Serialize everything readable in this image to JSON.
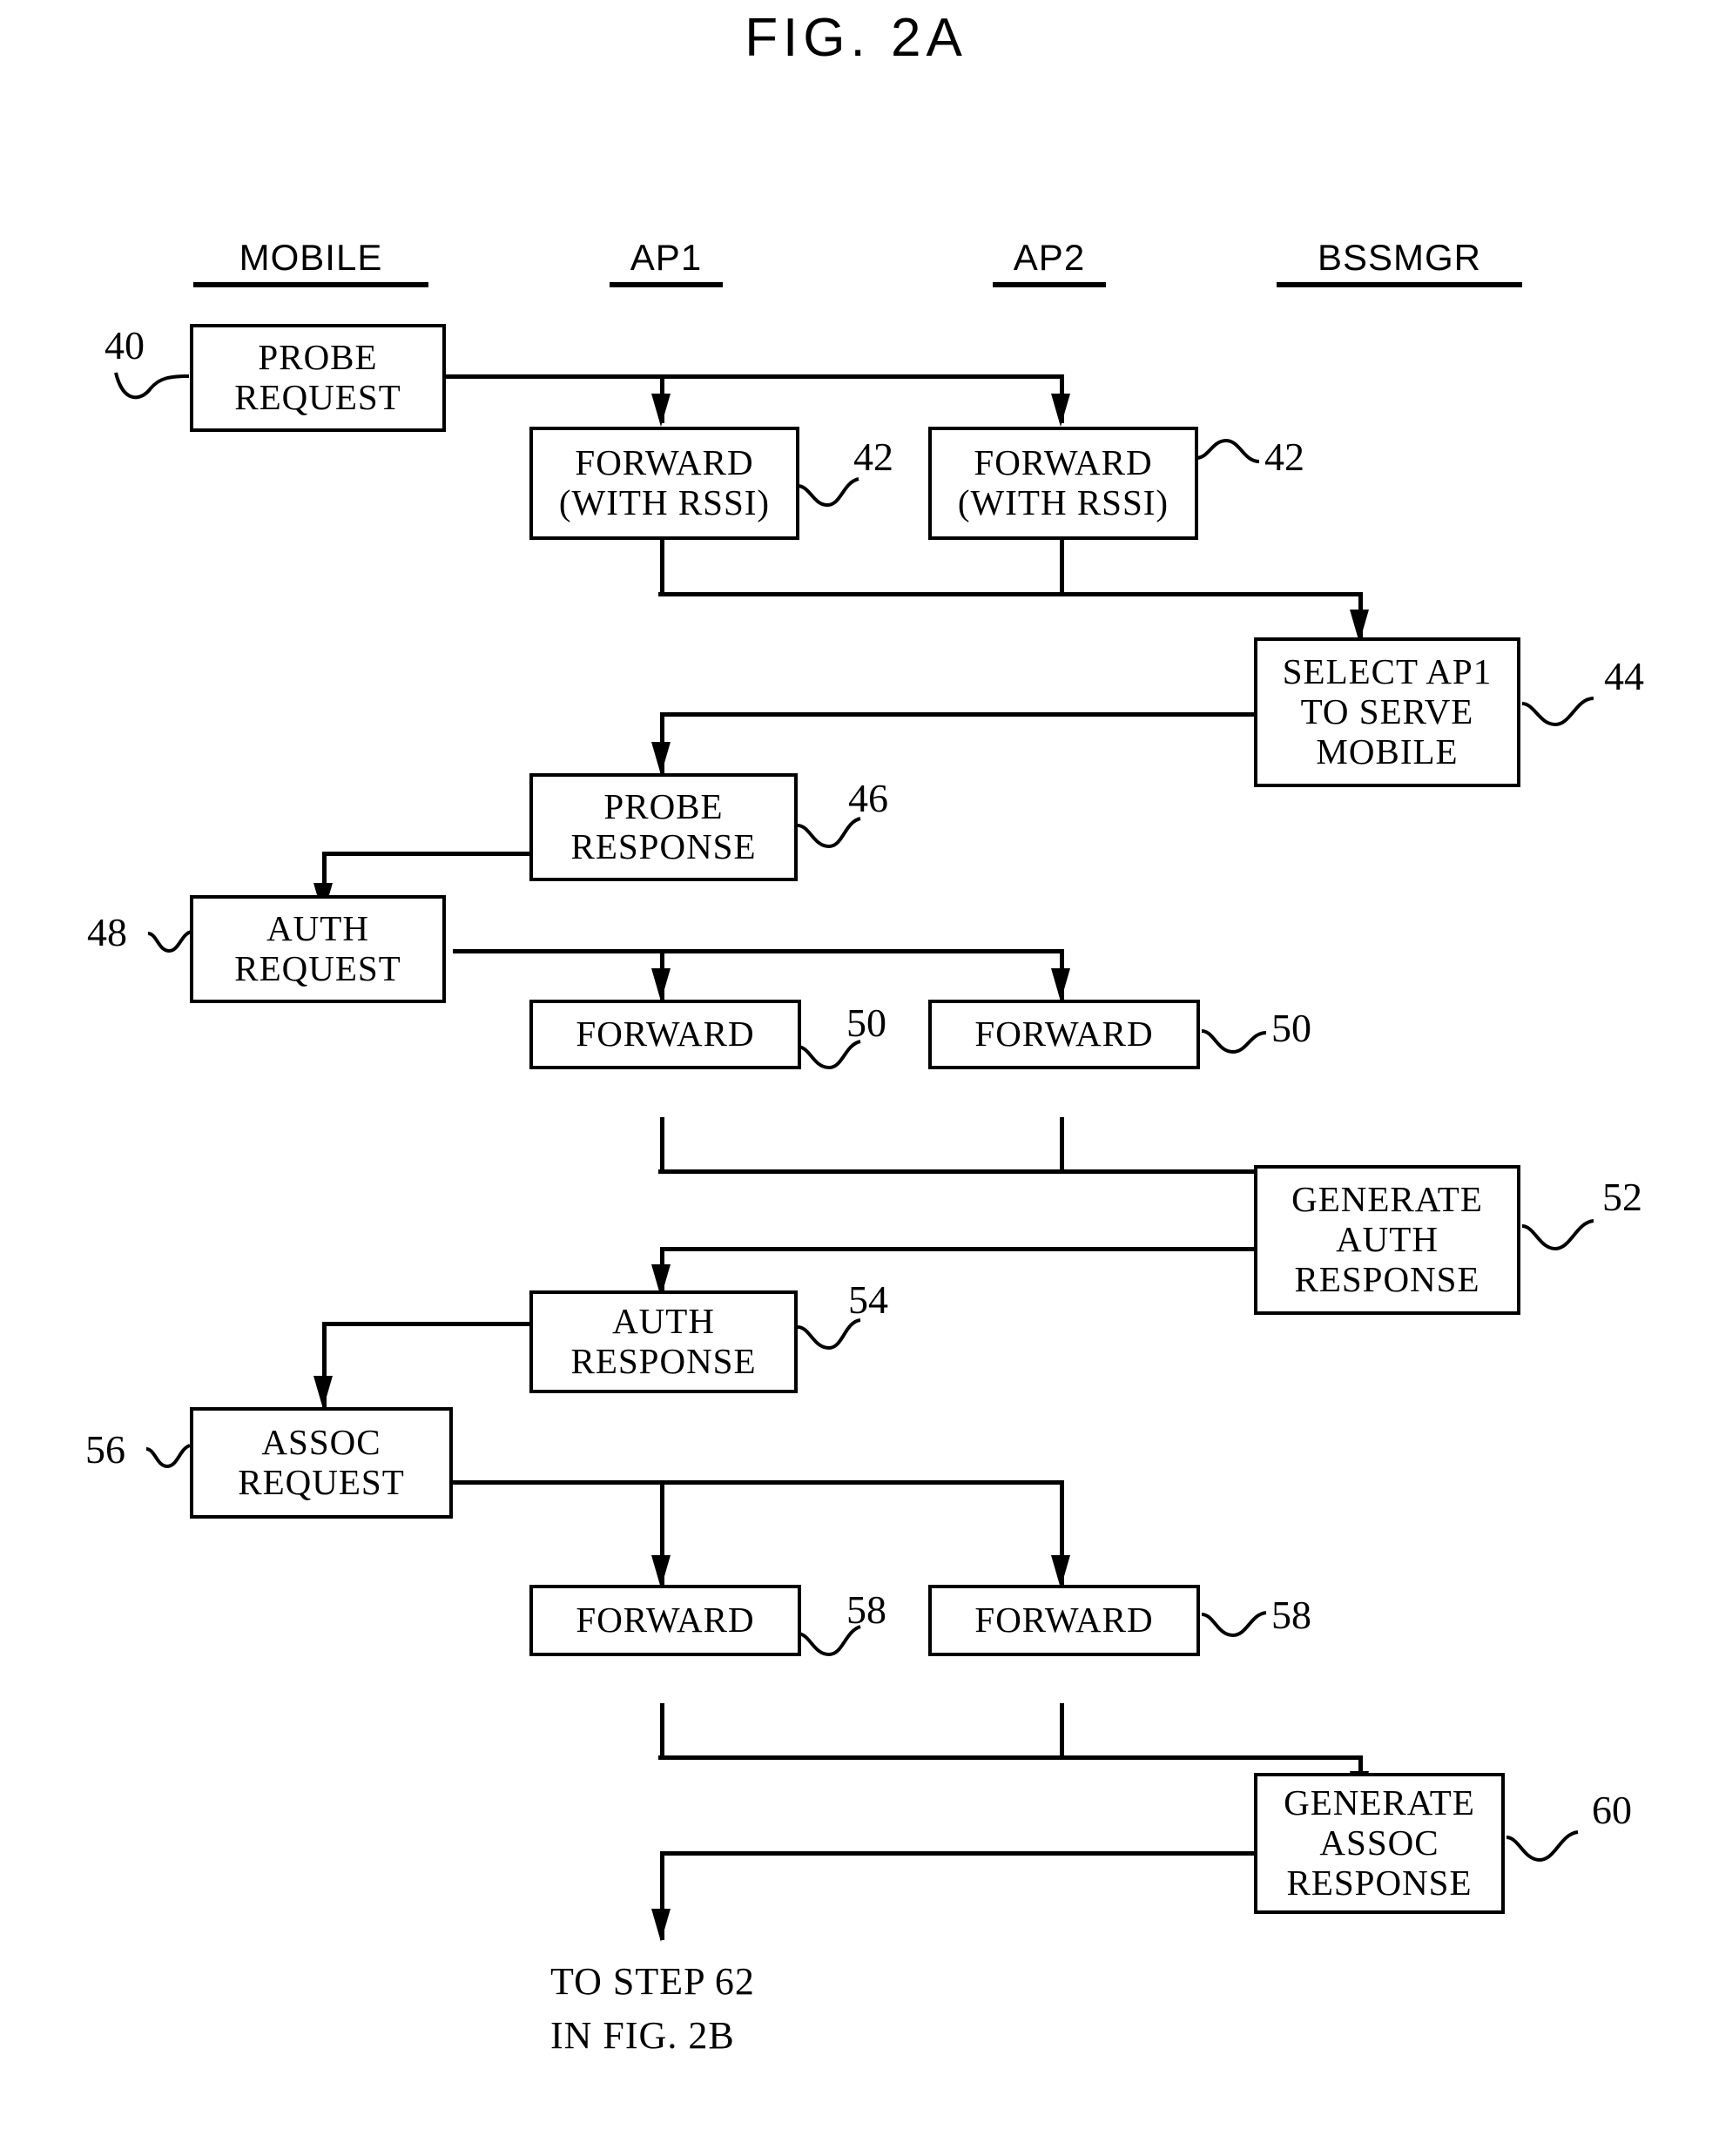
{
  "figure": {
    "title": "FIG. 2A",
    "columns": [
      {
        "label": "MOBILE"
      },
      {
        "label": "AP1"
      },
      {
        "label": "AP2"
      },
      {
        "label": "BSSMGR"
      }
    ]
  },
  "nodes": [
    {
      "id": "n40",
      "ref": "40",
      "lines": [
        "PROBE",
        "REQUEST"
      ],
      "lane": "MOBILE"
    },
    {
      "id": "n42a",
      "ref": "42",
      "lines": [
        "FORWARD",
        "(WITH RSSI)"
      ],
      "lane": "AP1"
    },
    {
      "id": "n42b",
      "ref": "42",
      "lines": [
        "FORWARD",
        "(WITH RSSI)"
      ],
      "lane": "AP2"
    },
    {
      "id": "n44",
      "ref": "44",
      "lines": [
        "SELECT AP1",
        "TO SERVE",
        "MOBILE"
      ],
      "lane": "BSSMGR"
    },
    {
      "id": "n46",
      "ref": "46",
      "lines": [
        "PROBE",
        "RESPONSE"
      ],
      "lane": "AP1"
    },
    {
      "id": "n48",
      "ref": "48",
      "lines": [
        "AUTH",
        "REQUEST"
      ],
      "lane": "MOBILE"
    },
    {
      "id": "n50a",
      "ref": "50",
      "lines": [
        "FORWARD"
      ],
      "lane": "AP1"
    },
    {
      "id": "n50b",
      "ref": "50",
      "lines": [
        "FORWARD"
      ],
      "lane": "AP2"
    },
    {
      "id": "n52",
      "ref": "52",
      "lines": [
        "GENERATE",
        "AUTH",
        "RESPONSE"
      ],
      "lane": "BSSMGR"
    },
    {
      "id": "n54",
      "ref": "54",
      "lines": [
        "AUTH",
        "RESPONSE"
      ],
      "lane": "AP1"
    },
    {
      "id": "n56",
      "ref": "56",
      "lines": [
        "ASSOC",
        "REQUEST"
      ],
      "lane": "MOBILE"
    },
    {
      "id": "n58a",
      "ref": "58",
      "lines": [
        "FORWARD"
      ],
      "lane": "AP1"
    },
    {
      "id": "n58b",
      "ref": "58",
      "lines": [
        "FORWARD"
      ],
      "lane": "AP2"
    },
    {
      "id": "n60",
      "ref": "60",
      "lines": [
        "GENERATE",
        "ASSOC",
        "RESPONSE"
      ],
      "lane": "BSSMGR"
    }
  ],
  "continuation": {
    "line1": "TO STEP 62",
    "line2": "IN FIG. 2B"
  },
  "colors": {
    "ink": "#000000",
    "paper": "#ffffff"
  }
}
